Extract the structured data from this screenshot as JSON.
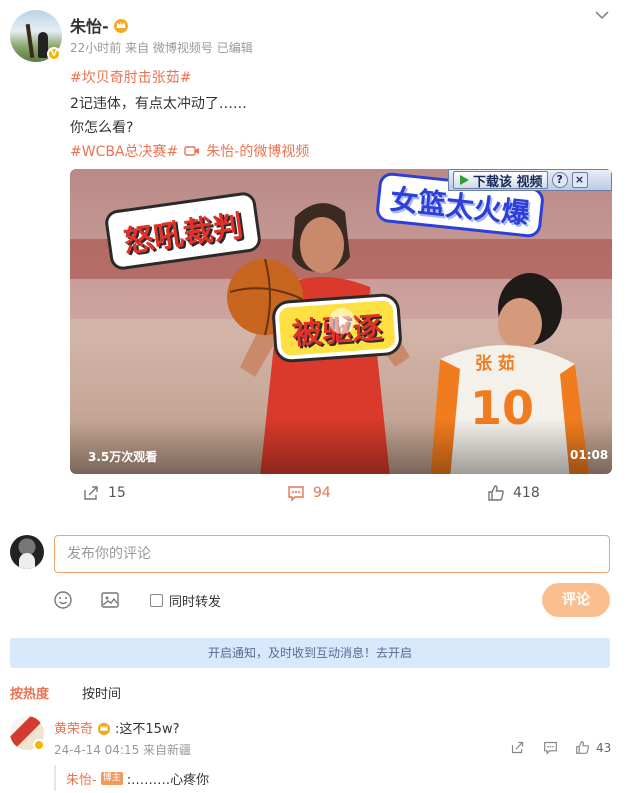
{
  "post": {
    "author": "朱怡-",
    "meta": "22小时前  来自 微博视频号 已编辑",
    "hashtag1": "#坎贝奇肘击张茹#",
    "line2": "2记违体，有点太冲动了……",
    "line3": "你怎么看?",
    "hashtag2": "#WCBA总决赛#",
    "video_link": "朱怡-的微博视频"
  },
  "video": {
    "sticker1": "怒吼裁判",
    "sticker2": "女篮太火爆",
    "sticker3": "被驱逐",
    "download_label": "下载该 视频",
    "help": "?",
    "close": "×",
    "views": "3.5万次观看",
    "duration": "01:08",
    "jersey_name": "张 茹",
    "jersey_number": "10"
  },
  "actions": {
    "shares": "15",
    "comments": "94",
    "likes": "418"
  },
  "composer": {
    "placeholder": "发布你的评论",
    "repost_label": "同时转发",
    "submit_label": "评论"
  },
  "notice": "开启通知，及时收到互动消息！去开启",
  "sort": {
    "hot": "按热度",
    "time": "按时间"
  },
  "comment": {
    "name": "黄荣奇",
    "text": ":这不15w?",
    "meta": "24-4-14 04:15 来自新疆",
    "likes": "43",
    "reply": {
      "name": "朱怡-",
      "badge": "博主",
      "text": ":………心疼你"
    }
  },
  "colors": {
    "accent": "#eb7350",
    "submit_bg": "#fbbf8f",
    "notice_bg": "#d8e9fb",
    "verified_badge": "#f7b500"
  },
  "icons": [
    "chevron-down-icon",
    "crown-icon",
    "video-camera-icon",
    "share-icon",
    "comment-icon",
    "like-icon",
    "emoji-icon",
    "image-icon",
    "play-icon"
  ]
}
